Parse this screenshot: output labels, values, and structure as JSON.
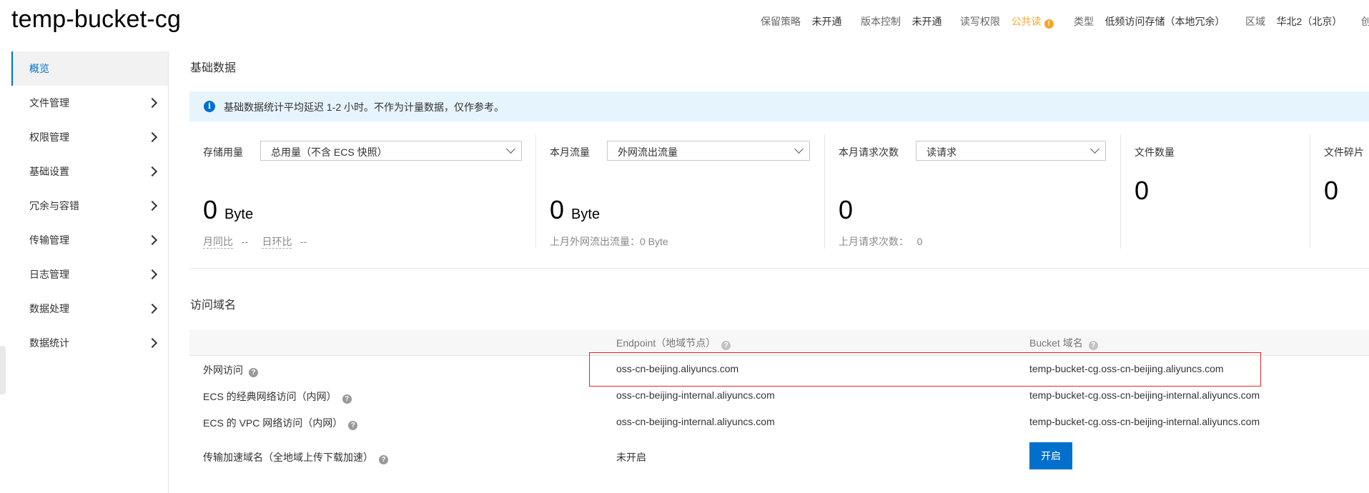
{
  "header": {
    "title": "temp-bucket-cg",
    "meta": [
      {
        "key": "保留策略",
        "value": "未开通"
      },
      {
        "key": "版本控制",
        "value": "未开通"
      },
      {
        "key": "读写权限",
        "value": "公共读",
        "status": "warning"
      },
      {
        "key": "类型",
        "value": "低频访问存储（本地冗余）"
      },
      {
        "key": "区域",
        "value": "华北2（北京）"
      },
      {
        "key": "创",
        "value": ""
      }
    ]
  },
  "sidebar": {
    "items": [
      {
        "label": "概览",
        "active": true
      },
      {
        "label": "文件管理"
      },
      {
        "label": "权限管理"
      },
      {
        "label": "基础设置"
      },
      {
        "label": "冗余与容错"
      },
      {
        "label": "传输管理"
      },
      {
        "label": "日志管理"
      },
      {
        "label": "数据处理"
      },
      {
        "label": "数据统计"
      }
    ]
  },
  "basic": {
    "heading": "基础数据",
    "notice": "基础数据统计平均延迟 1-2 小时。不作为计量数据，仅作参考。",
    "stats": [
      {
        "label": "存储用量",
        "select": "总用量（不含 ECS 快照）",
        "value": "0",
        "unit": "Byte",
        "sub1": "月同比",
        "sub1_val": "--",
        "sub2": "日环比",
        "sub2_val": "--"
      },
      {
        "label": "本月流量",
        "select": "外网流出流量",
        "value": "0",
        "unit": "Byte",
        "sub": "上月外网流出流量：0 Byte"
      },
      {
        "label": "本月请求次数",
        "select": "读请求",
        "value": "0",
        "sub": "上月请求次数：",
        "sub_val": "0"
      },
      {
        "label": "文件数量",
        "value": "0"
      },
      {
        "label": "文件碎片",
        "value": "0"
      }
    ]
  },
  "domains": {
    "heading": "访问域名",
    "columns": [
      "Endpoint（地域节点）",
      "Bucket 域名"
    ],
    "rows": [
      {
        "name": "外网访问",
        "endpoint": "oss-cn-beijing.aliyuncs.com",
        "bucket": "temp-bucket-cg.oss-cn-beijing.aliyuncs.com"
      },
      {
        "name": "ECS 的经典网络访问（内网）",
        "endpoint": "oss-cn-beijing-internal.aliyuncs.com",
        "bucket": "temp-bucket-cg.oss-cn-beijing-internal.aliyuncs.com"
      },
      {
        "name": "ECS 的 VPC 网络访问（内网）",
        "endpoint": "oss-cn-beijing-internal.aliyuncs.com",
        "bucket": "temp-bucket-cg.oss-cn-beijing-internal.aliyuncs.com"
      },
      {
        "name": "传输加速域名（全地域上传下载加速）",
        "endpoint": "未开启",
        "button": "开启"
      }
    ]
  },
  "colors": {
    "accent": "#0070cc",
    "warning": "#f5a623",
    "highlight": "#e0262b"
  }
}
